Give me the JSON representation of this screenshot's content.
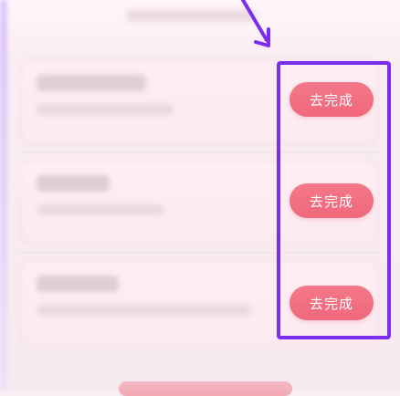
{
  "tasks": [
    {
      "button_label": "去完成"
    },
    {
      "button_label": "去完成"
    },
    {
      "button_label": "去完成"
    }
  ],
  "colors": {
    "button": "#f0687b",
    "highlight": "#7b2df0",
    "background": "#f9eef3"
  }
}
